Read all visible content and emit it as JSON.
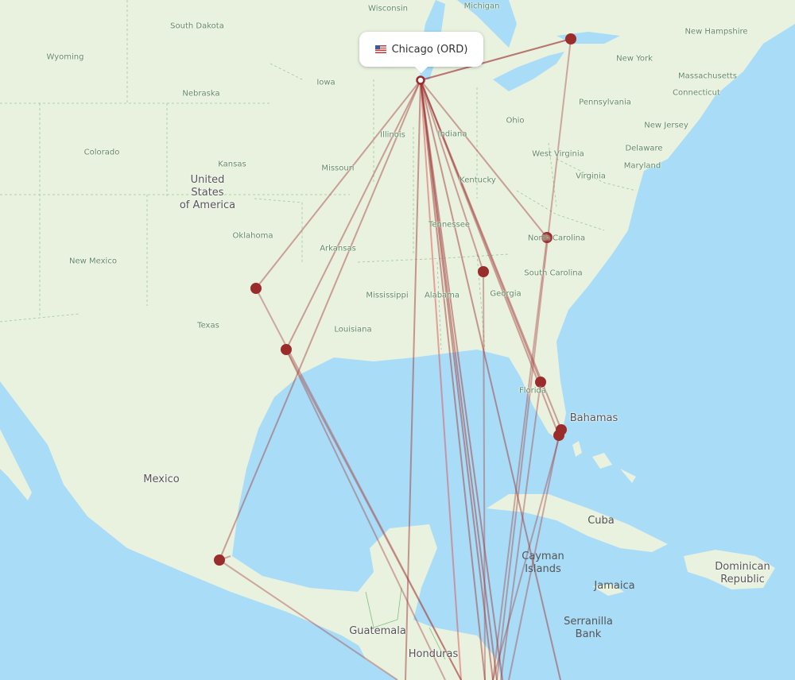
{
  "map": {
    "colors": {
      "water": "#a9dcf7",
      "land": "#e9f1df",
      "border": "#9bc99b",
      "route": "#a23a3a",
      "route_highlight": "#e05050",
      "airport": "#9b2c2c"
    },
    "origin_popup": {
      "flag_icon": "us-flag-icon",
      "label": "Chicago (ORD)"
    },
    "labels": {
      "states": [
        "Wisconsin",
        "Michigan",
        "South Dakota",
        "Wyoming",
        "Iowa",
        "Nebraska",
        "Colorado",
        "Kansas",
        "Illinois",
        "Indiana",
        "Ohio",
        "Missouri",
        "Kentucky",
        "West Virginia",
        "Virginia",
        "Oklahoma",
        "Tennessee",
        "Arkansas",
        "New Mexico",
        "Mississippi",
        "Alabama",
        "Georgia",
        "Texas",
        "Louisiana",
        "Florida",
        "North Carolina",
        "South Carolina",
        "Pennsylvania",
        "New York",
        "New Hampshire",
        "Massachusetts",
        "Connecticut",
        "New Jersey",
        "Delaware",
        "Maryland"
      ],
      "countries": {
        "usa": "United States of America",
        "mexico": "Mexico",
        "bahamas": "Bahamas",
        "cuba": "Cuba",
        "cayman": "Cayman Islands",
        "jamaica": "Jamaica",
        "serranilla": "Serranilla Bank",
        "dominican": "Dominican Republic",
        "guatemala": "Guatemala",
        "honduras": "Honduras"
      }
    }
  }
}
